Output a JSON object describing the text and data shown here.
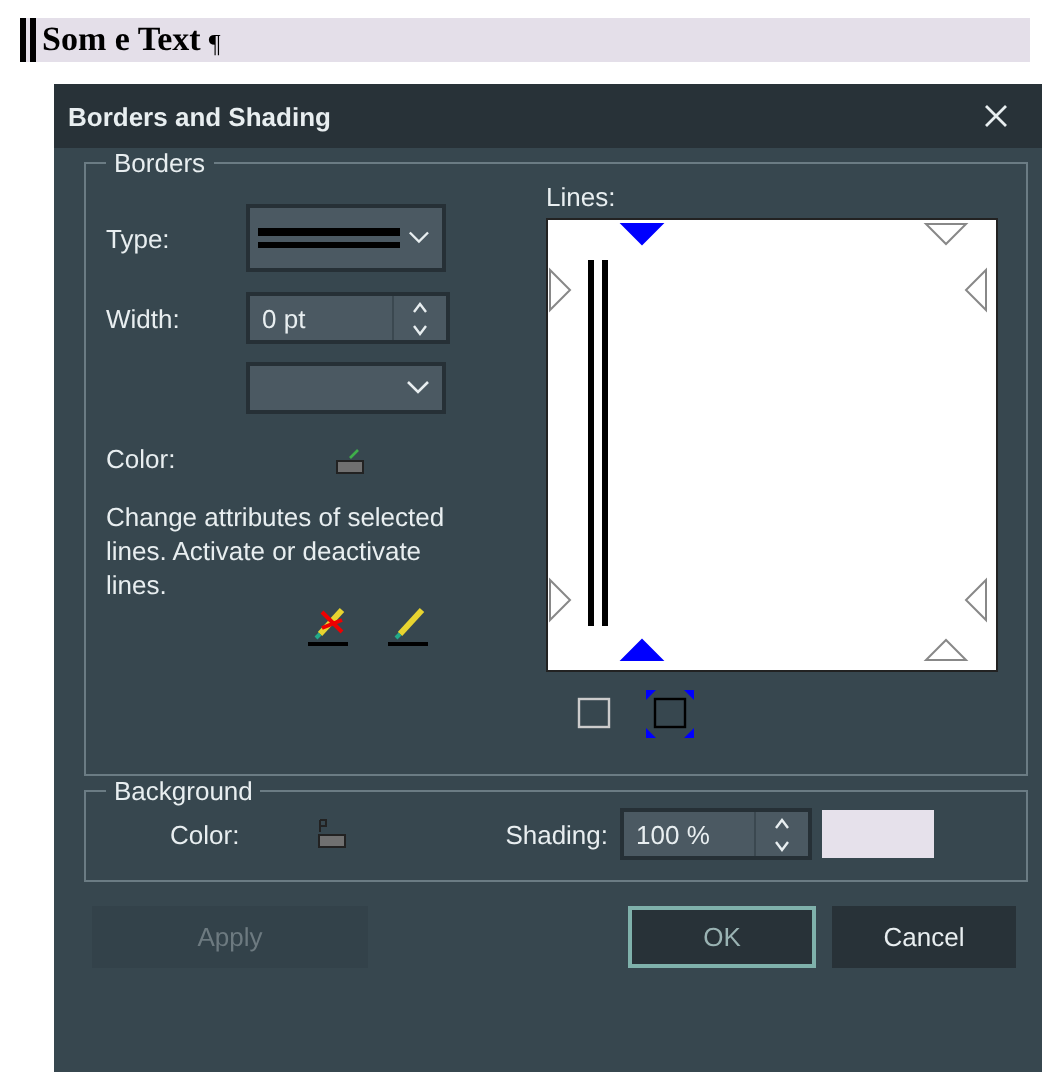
{
  "document": {
    "text": "Som e Text",
    "pilcrow": "¶"
  },
  "dialog": {
    "title": "Borders and Shading"
  },
  "borders": {
    "legend": "Borders",
    "type_label": "Type:",
    "width_label": "Width:",
    "width_value": "0 pt",
    "color_label": "Color:",
    "hint": "Change attributes of selected lines. Activate or deactivate lines.",
    "lines_label": "Lines:",
    "markers": [
      {
        "selected": true
      },
      {
        "selected": false
      },
      {
        "selected": false
      },
      {
        "selected": false
      },
      {
        "selected": false
      },
      {
        "selected": false
      },
      {
        "selected": true
      },
      {
        "selected": false
      }
    ],
    "presets": [
      {
        "selected": false
      },
      {
        "selected": true
      }
    ]
  },
  "background": {
    "legend": "Background",
    "color_label": "Color:",
    "shading_label": "Shading:",
    "shading_value": "100 %"
  },
  "buttons": [
    {
      "label": "Apply",
      "disabled": true,
      "focused": false
    },
    {
      "label": "OK",
      "disabled": false,
      "focused": true
    },
    {
      "label": "Cancel",
      "disabled": false,
      "focused": false
    }
  ]
}
